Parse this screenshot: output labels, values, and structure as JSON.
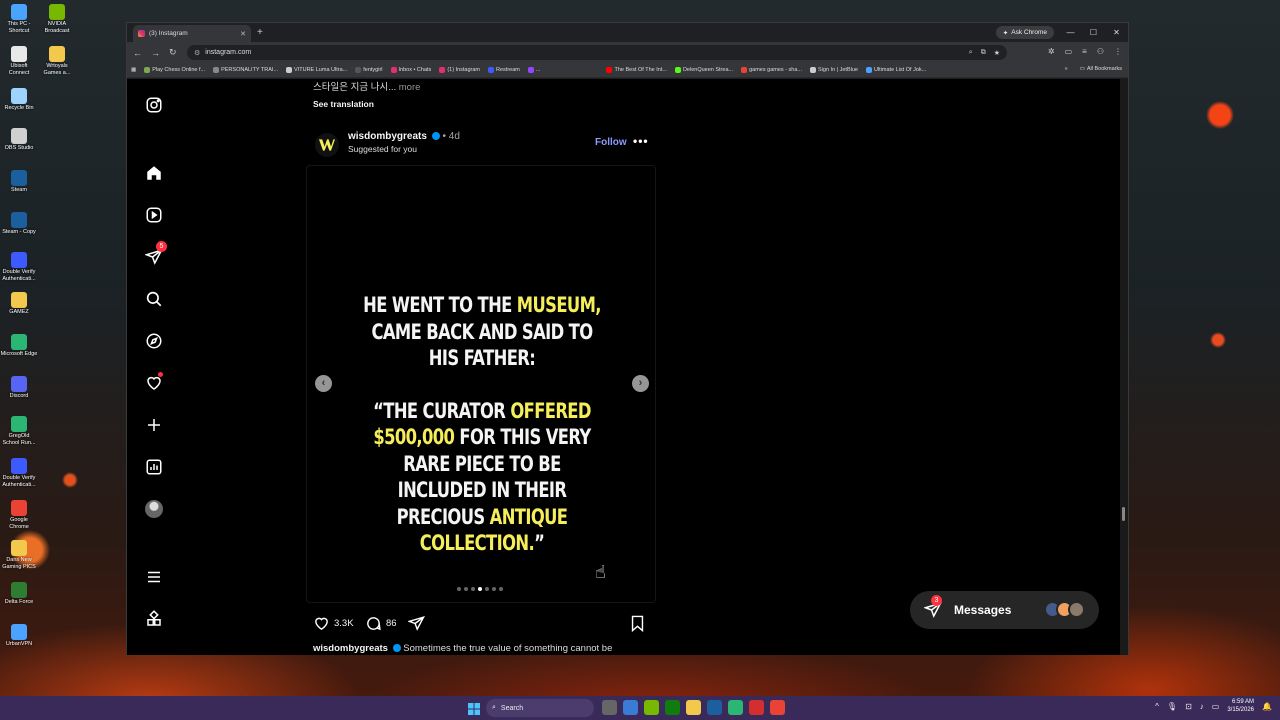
{
  "desktop": {
    "icons": [
      {
        "label": "This PC - Shortcut",
        "color": "#4aa3ff"
      },
      {
        "label": "NVIDIA Broadcast",
        "color": "#76b900"
      },
      {
        "label": "Ubisoft Connect",
        "color": "#e8e8e8"
      },
      {
        "label": "Wrtoyals Games a...",
        "color": "#f2c94c"
      },
      {
        "label": "Recycle Bin",
        "color": "#9fd3ff"
      },
      {
        "label": "OBS Studio",
        "color": "#d0d0d0"
      },
      {
        "label": "Steam",
        "color": "#1b5f9e"
      },
      {
        "label": "Steam - Copy",
        "color": "#1b5f9e"
      },
      {
        "label": "Double Verify Authenticati...",
        "color": "#3d5afe"
      },
      {
        "label": "GAMEZ",
        "color": "#f2c94c"
      },
      {
        "label": "Microsoft Edge",
        "color": "#2bb673"
      },
      {
        "label": "Discord",
        "color": "#5865f2"
      },
      {
        "label": "GregOld School Run...",
        "color": "#2bb673"
      },
      {
        "label": "Double Verify Authenticati...",
        "color": "#3d5afe"
      },
      {
        "label": "Google Chrome",
        "color": "#ea4335"
      },
      {
        "label": "Dans New Gaming PICS",
        "color": "#f2c94c"
      },
      {
        "label": "Delta Force",
        "color": "#2e7d32"
      },
      {
        "label": "UrbanVPN",
        "color": "#4aa3ff"
      }
    ]
  },
  "browser": {
    "tab_title": "(3) Instagram",
    "new_tab": "+",
    "ask_chrome": "Ask Chrome",
    "url": "instagram.com",
    "bookmarks": [
      {
        "label": "Play Chess Online f...",
        "color": "#7fa650"
      },
      {
        "label": "PERSONALITY TRAI...",
        "color": "#888888"
      },
      {
        "label": "VITURE Luma Ultra...",
        "color": "#cccccc"
      },
      {
        "label": "fentygirl",
        "color": "#555555"
      },
      {
        "label": "Inbox • Chats",
        "color": "#e1306c"
      },
      {
        "label": "(1) Instagram",
        "color": "#e1306c"
      },
      {
        "label": "Restream",
        "color": "#3d5afe"
      },
      {
        "label": "...",
        "color": "#9146ff"
      },
      {
        "label": "The Best Of The Int...",
        "color": "#ff0000"
      },
      {
        "label": "DelenQueen Strea...",
        "color": "#53fc18"
      },
      {
        "label": "games games - sha...",
        "color": "#ea4335"
      },
      {
        "label": "Sign In | JetBlue",
        "color": "#cccccc"
      },
      {
        "label": "Ultimate List Of Jok...",
        "color": "#4aa3ff"
      }
    ],
    "all_bookmarks": "All Bookmarks"
  },
  "instagram": {
    "nav_badge": "5",
    "caption_top": "스타일은 지금 나시... ",
    "caption_more": "more",
    "see_translation": "See translation",
    "post": {
      "author": "wisdombygreats",
      "time": "• 4d",
      "suggested": "Suggested for you",
      "follow": "Follow",
      "quote_line1_a": "HE WENT TO THE ",
      "quote_line1_hl": "MUSEUM,",
      "quote_line1_b": " CAME BACK AND SAID TO HIS FATHER:",
      "quote_line2_a": "“THE CURATOR ",
      "quote_line2_hl": "OFFERED $500,000",
      "quote_line2_b": " FOR THIS VERY RARE PIECE TO BE INCLUDED IN THEIR PRECIOUS ",
      "quote_line2_hl2": "ANTIQUE COLLECTION.",
      "quote_line2_c": "”",
      "likes": "3.3K",
      "comments": "86",
      "caption_author": "wisdombygreats",
      "caption_text": "Sometimes the true value of something cannot be",
      "slides_total": 7,
      "slide_current": 4
    },
    "messages": {
      "label": "Messages",
      "badge": "3"
    }
  },
  "taskbar": {
    "search": "Search",
    "time": "6:59 AM",
    "date": "3/15/2026"
  }
}
